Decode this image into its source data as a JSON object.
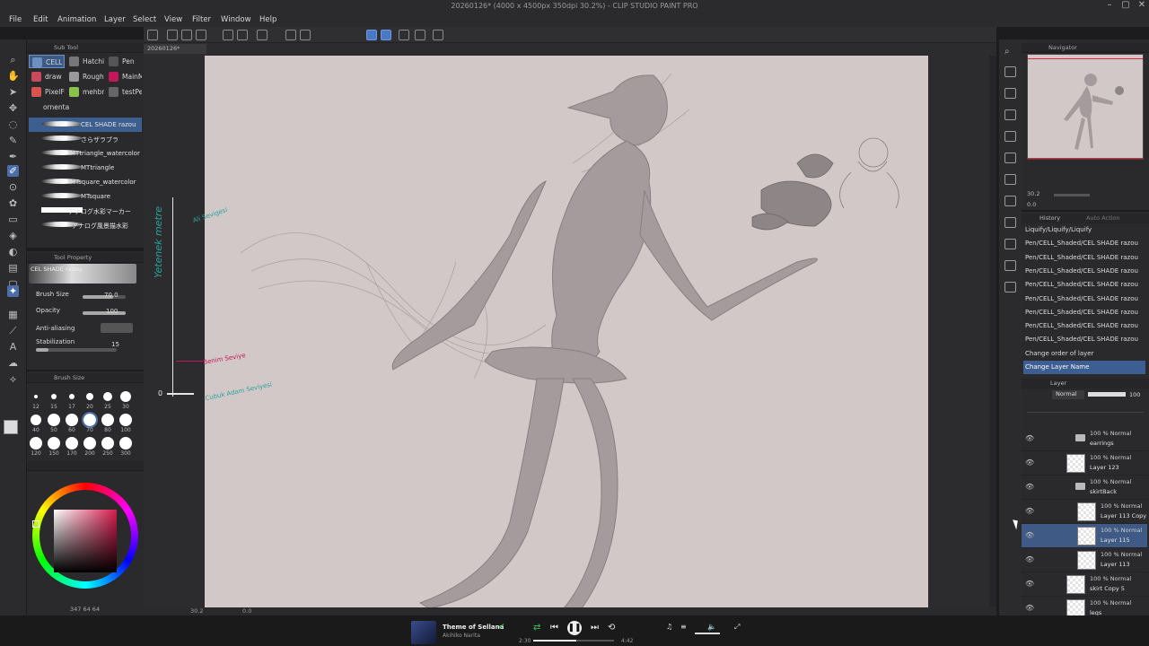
{
  "app": {
    "title": "20260126* (4000 x 4500px 350dpi 30.2%) - CLIP STUDIO PAINT PRO"
  },
  "menu": [
    "File",
    "Edit",
    "Animation",
    "Layer",
    "Select",
    "View",
    "Filter",
    "Window",
    "Help"
  ],
  "doc_tab": "20260126*",
  "subtool": {
    "header": "Sub Tool",
    "tabs": [
      "CELL",
      "Hatchi",
      "Pen",
      "draw",
      "Rough",
      "MainM",
      "PixelFu",
      "mehbru",
      "testPe",
      "ornenta"
    ],
    "brushes": [
      "CEL SHADE razou",
      "さらザラブラ",
      "MTtriangle_watercolor",
      "MTtriangle",
      "MTsquare_watercolor",
      "MTsquare",
      "アナログ水彩マーカー",
      "アナログ風景描水彩"
    ]
  },
  "tool_property": {
    "header": "Tool Property",
    "brush_name": "CEL SHADE razou",
    "brush_size_label": "Brush Size",
    "brush_size_value": "70.0",
    "brush_size_fraction": 0.7,
    "opacity_label": "Opacity",
    "opacity_value": "100",
    "opacity_fraction": 1.0,
    "antialias_label": "Anti-aliasing",
    "stabilization_label": "Stabilization",
    "stabilization_value": "15",
    "stabilization_fraction": 0.15
  },
  "brush_size_panel": {
    "header": "Brush Size",
    "sizes": [
      "12",
      "15",
      "17",
      "20",
      "25",
      "30",
      "40",
      "50",
      "60",
      "70",
      "80",
      "100",
      "120",
      "150",
      "170",
      "200",
      "250",
      "300"
    ]
  },
  "color_panel": {
    "hue_color": "#d81b4d",
    "readout": "347  64  64"
  },
  "canvas": {
    "zoom": "30.2",
    "rotation": "0.0",
    "annotations": {
      "ruler_title": "Yetenek metre",
      "top_note": "Ali Sevigesi",
      "me_note": "Benim Seviye",
      "bottom_note": "Cubuk Adam Seviyesi",
      "zero": "0"
    }
  },
  "navigator": {
    "header": "Navigator",
    "zoom": "30.2",
    "rotation": "0.0"
  },
  "history": {
    "tabs": [
      "History",
      "Auto Action"
    ],
    "items": [
      "Liquify/Liquify/Liquify",
      "Pen/CELL_Shaded/CEL SHADE razou",
      "Pen/CELL_Shaded/CEL SHADE razou",
      "Pen/CELL_Shaded/CEL SHADE razou",
      "Pen/CELL_Shaded/CEL SHADE razou",
      "Pen/CELL_Shaded/CEL SHADE razou",
      "Pen/CELL_Shaded/CEL SHADE razou",
      "Pen/CELL_Shaded/CEL SHADE razou",
      "Pen/CELL_Shaded/CEL SHADE razou",
      "Change order of layer",
      "Change Layer Name"
    ]
  },
  "layers": {
    "header": "Layer",
    "blend_mode": "Normal",
    "opacity": "100",
    "items": [
      {
        "mode": "100 % Normal",
        "name": "earrings"
      },
      {
        "mode": "100 % Normal",
        "name": "Layer 123"
      },
      {
        "mode": "100 % Normal",
        "name": "skirtBack"
      },
      {
        "mode": "100 % Normal",
        "name": "Layer 113 Copy"
      },
      {
        "mode": "100 % Normal",
        "name": "Layer 115"
      },
      {
        "mode": "100 % Normal",
        "name": "Layer 113"
      },
      {
        "mode": "100 % Normal",
        "name": "skirt Copy 5"
      },
      {
        "mode": "100 % Normal",
        "name": "legs"
      }
    ]
  },
  "media": {
    "title": "Theme of Sellana",
    "artist": "Akihiko Narita",
    "elapsed": "2:30",
    "total": "4:42",
    "progress": 0.53
  }
}
